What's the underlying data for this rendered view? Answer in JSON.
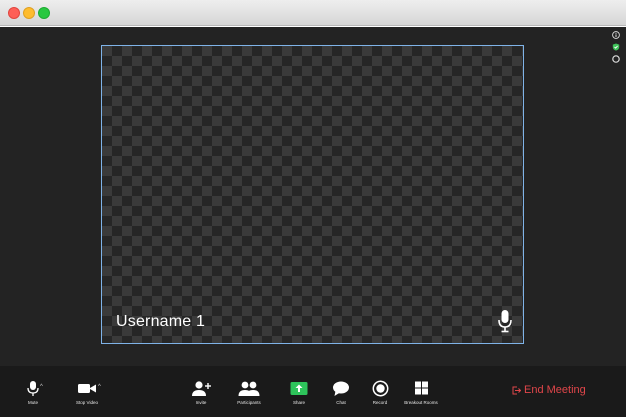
{
  "window": {
    "controls": [
      "close",
      "minimize",
      "zoom"
    ]
  },
  "video": {
    "username": "Username 1",
    "mic_icon": "microphone-icon"
  },
  "side_status": [
    {
      "icon": "info-icon"
    },
    {
      "icon": "shield-check-icon",
      "color": "#3fc35a"
    },
    {
      "icon": "record-dot-icon"
    }
  ],
  "toolbar": {
    "mute_label": "Mute",
    "stop_video_label": "Stop Video",
    "invite_label": "Invite",
    "participants_label": "Participants",
    "share_label": "Share",
    "chat_label": "Chat",
    "record_label": "Record",
    "breakout_label": "Breakout Rooms",
    "end_meeting_label": "End Meeting",
    "caret": "^"
  },
  "colors": {
    "share_green": "#2ec45b",
    "end_meeting_red": "#e0464a",
    "tile_border": "#7fb3e8",
    "toolbar_bg": "#1a1a1a",
    "stage_bg": "#232323"
  }
}
